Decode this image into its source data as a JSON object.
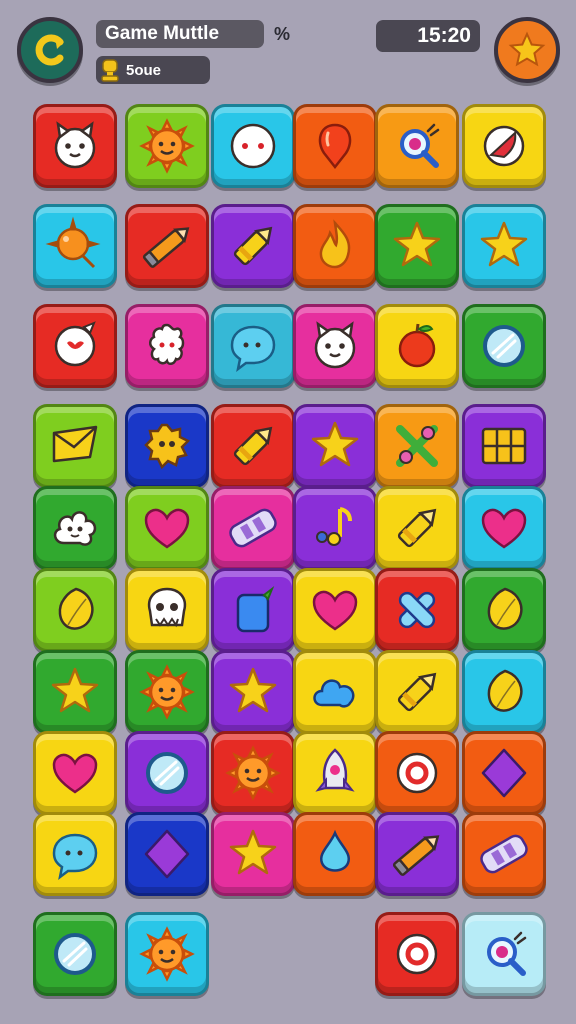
{
  "header": {
    "title": "Game Muttle",
    "percent_symbol": "%",
    "score_label": "5oue",
    "timer": "15:20"
  },
  "colors": {
    "red": "#e62b24",
    "lime": "#7fce1f",
    "cyan": "#29c6e8",
    "orange": "#f25c12",
    "amber": "#f79a14",
    "yellow": "#f7d613",
    "purple": "#8a2fd8",
    "green": "#31a92f",
    "magenta": "#e62f9e",
    "navy": "#1a38c8",
    "teal": "#36b8d6",
    "paleblue": "#b7ecf7"
  },
  "board": [
    [
      {
        "color": "red",
        "icon": "cat-face-icon"
      },
      {
        "color": "lime",
        "icon": "sun-face-icon"
      },
      {
        "color": "cyan",
        "icon": "ghost-face-icon"
      },
      {
        "color": "orange",
        "icon": "balloon-icon"
      },
      {
        "color": "amber",
        "icon": "magnifier-icon"
      },
      {
        "color": "yellow",
        "icon": "ball-icon"
      }
    ],
    [
      {
        "color": "cyan",
        "icon": "spiky-ball-icon"
      },
      {
        "color": "red",
        "icon": "pencil-icon"
      },
      {
        "color": "purple",
        "icon": "crayon-icon"
      },
      {
        "color": "orange",
        "icon": "flame-icon"
      },
      {
        "color": "green",
        "icon": "star-icon"
      },
      {
        "color": "cyan",
        "icon": "star-icon"
      }
    ],
    [
      {
        "color": "red",
        "icon": "speech-bubble-icon"
      },
      {
        "color": "magenta",
        "icon": "flower-face-icon"
      },
      {
        "color": "teal",
        "icon": "chat-bubble-icon"
      },
      {
        "color": "magenta",
        "icon": "cat-face-icon"
      },
      {
        "color": "yellow",
        "icon": "apple-icon"
      },
      {
        "color": "green",
        "icon": "mirror-icon"
      }
    ],
    [
      {
        "color": "lime",
        "icon": "envelope-icon"
      },
      {
        "color": "navy",
        "icon": "gear-face-icon"
      },
      {
        "color": "red",
        "icon": "crayon-icon"
      },
      {
        "color": "purple",
        "icon": "star-icon"
      },
      {
        "color": "amber",
        "icon": "scissors-icon"
      },
      {
        "color": "purple",
        "icon": "window-icon"
      }
    ],
    [
      {
        "color": "green",
        "icon": "cloud-face-icon"
      },
      {
        "color": "lime",
        "icon": "heart-icon"
      },
      {
        "color": "magenta",
        "icon": "bandage-icon"
      },
      {
        "color": "purple",
        "icon": "music-note-icon"
      },
      {
        "color": "yellow",
        "icon": "crayon-icon"
      },
      {
        "color": "cyan",
        "icon": "heart-icon"
      }
    ],
    [
      {
        "color": "lime",
        "icon": "leaf-icon"
      },
      {
        "color": "yellow",
        "icon": "skull-icon"
      },
      {
        "color": "purple",
        "icon": "jar-icon"
      },
      {
        "color": "yellow",
        "icon": "heart-icon"
      },
      {
        "color": "red",
        "icon": "safety-pin-icon"
      },
      {
        "color": "green",
        "icon": "leaf-icon"
      }
    ],
    [
      {
        "color": "green",
        "icon": "star-icon"
      },
      {
        "color": "green",
        "icon": "sun-face-icon"
      },
      {
        "color": "purple",
        "icon": "star-icon"
      },
      {
        "color": "yellow",
        "icon": "cloud-icon"
      },
      {
        "color": "yellow",
        "icon": "crayon-icon"
      },
      {
        "color": "cyan",
        "icon": "leaf-icon"
      }
    ],
    [
      {
        "color": "yellow",
        "icon": "heart-icon"
      },
      {
        "color": "purple",
        "icon": "mirror-icon"
      },
      {
        "color": "red",
        "icon": "sun-face-icon"
      },
      {
        "color": "yellow",
        "icon": "rocket-icon"
      },
      {
        "color": "orange",
        "icon": "donut-icon"
      },
      {
        "color": "orange",
        "icon": "diamond-icon"
      }
    ],
    [
      {
        "color": "yellow",
        "icon": "chat-bubble-icon"
      },
      {
        "color": "navy",
        "icon": "diamond-icon"
      },
      {
        "color": "magenta",
        "icon": "star-icon"
      },
      {
        "color": "orange",
        "icon": "drop-icon"
      },
      {
        "color": "purple",
        "icon": "pencil-icon"
      },
      {
        "color": "orange",
        "icon": "bandage-icon"
      }
    ],
    [
      {
        "color": "green",
        "icon": "mirror-icon"
      },
      {
        "color": "cyan",
        "icon": "sun-face-icon"
      },
      null,
      null,
      {
        "color": "red",
        "icon": "donut-icon"
      },
      {
        "color": "paleblue",
        "icon": "magnifier-icon"
      }
    ]
  ]
}
